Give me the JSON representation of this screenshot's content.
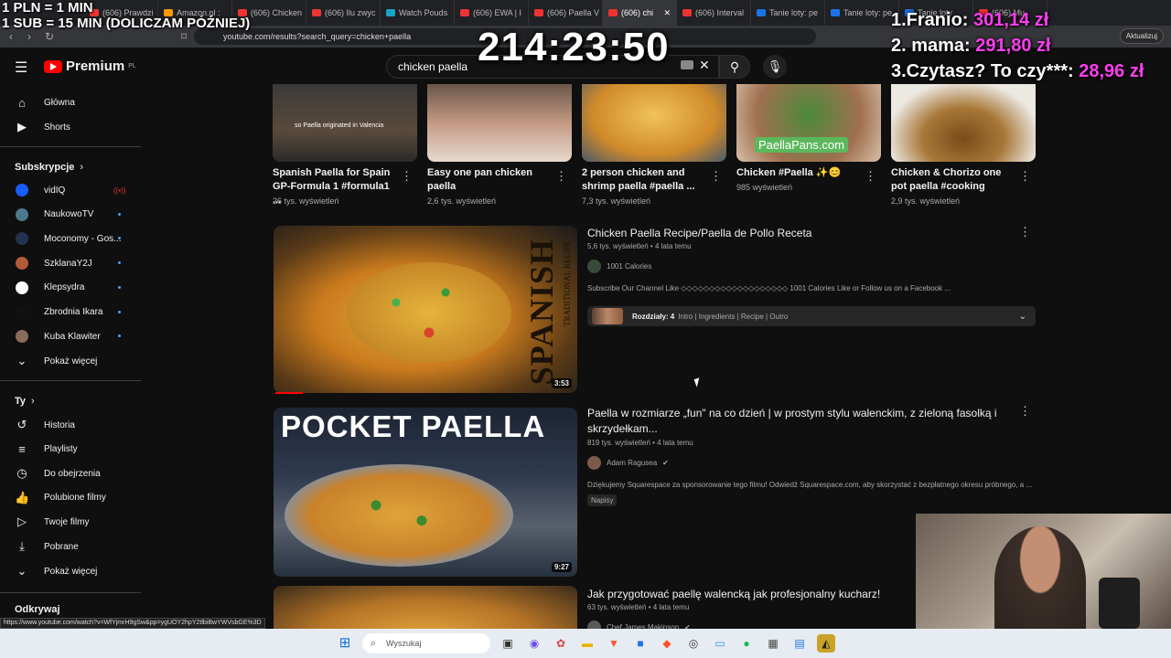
{
  "browser": {
    "tabs": [
      {
        "label": "(606) Prawdzi",
        "icon": "youtube"
      },
      {
        "label": "Amazon.pl :",
        "icon": "amazon"
      },
      {
        "label": "(606) Chicken",
        "icon": "youtube"
      },
      {
        "label": "(606) Ilu zwyc",
        "icon": "youtube"
      },
      {
        "label": "Watch Pouds",
        "icon": "watch"
      },
      {
        "label": "(606) EWA | I",
        "icon": "youtube"
      },
      {
        "label": "(606) Paella V",
        "icon": "youtube"
      },
      {
        "label": "(606) chi",
        "icon": "youtube",
        "active": true
      },
      {
        "label": "(606) Interval",
        "icon": "youtube"
      },
      {
        "label": "Tanie loty: pe",
        "icon": "flights"
      },
      {
        "label": "Tanie loty: pe",
        "icon": "flights"
      },
      {
        "label": "Tanie loty",
        "icon": "flights"
      },
      {
        "label": "(606) Mu",
        "icon": "youtube"
      }
    ],
    "url": "youtube.com/results?search_query=chicken+paella",
    "update_label": "Aktualizuj",
    "status_url": "https://www.youtube.com/watch?v=WfYjmrH9gSw&pp=ygUOY2hpY2tlbiBwYWVsbGE%3D"
  },
  "stream_overlay": {
    "rate_line1": "1 PLN = 1 MIN",
    "rate_line2": "1 SUB = 15 MIN (DOLICZAM PÓŹNIEJ)",
    "timer": "214:23:50",
    "leaderboard": [
      {
        "rank_name": "1.Franio:",
        "amount": "301,14 zł"
      },
      {
        "rank_name": "2. mama:",
        "amount": "291,80 zł"
      },
      {
        "rank_name": "3.Czytasz? To czy***:",
        "amount": "28,96 zł"
      }
    ]
  },
  "youtube": {
    "logo_text": "Premium",
    "logo_region": "PL",
    "search_query": "chicken paella",
    "sidebar": {
      "main": [
        {
          "label": "Główna",
          "icon": "home-icon"
        },
        {
          "label": "Shorts",
          "icon": "shorts-icon"
        }
      ],
      "subscriptions_header": "Subskrypcje",
      "subscriptions": [
        {
          "label": "vidIQ",
          "color": "#1a5cff"
        },
        {
          "label": "NaukowoTV",
          "color": "#4a7a8c"
        },
        {
          "label": "Moconomy - Gos...",
          "color": "#22314f"
        },
        {
          "label": "SzklanaY2J",
          "color": "#b35a3a"
        },
        {
          "label": "Klepsydra",
          "color": "#ffffff"
        },
        {
          "label": "Zbrodnia Ikara",
          "color": "#111111"
        },
        {
          "label": "Kuba Klawiter",
          "color": "#8a6a5a"
        }
      ],
      "show_more_1": "Pokaż więcej",
      "you_header": "Ty",
      "you_items": [
        {
          "label": "Historia",
          "icon": "history-icon"
        },
        {
          "label": "Playlisty",
          "icon": "playlist-icon"
        },
        {
          "label": "Do obejrzenia",
          "icon": "watch-later-icon"
        },
        {
          "label": "Polubione filmy",
          "icon": "like-icon"
        },
        {
          "label": "Twoje filmy",
          "icon": "your-videos-icon"
        },
        {
          "label": "Pobrane",
          "icon": "download-icon"
        }
      ],
      "show_more_2": "Pokaż więcej",
      "explore_header": "Odkrywaj"
    },
    "shorts": [
      {
        "title": "Spanish Paella for Spain GP-Formula 1 #formula1 ...",
        "views": "26 tys. wyświetleń",
        "caption": "so Paella originated in Valencia"
      },
      {
        "title": "Easy one pan chicken paella",
        "views": "2,6 tys. wyświetleń"
      },
      {
        "title": "2 person chicken and shrimp paella #paella ...",
        "views": "7,3 tys. wyświetleń"
      },
      {
        "title": "Chicken #Paella ✨😊",
        "views": "985 wyświetleń",
        "caption": "PaellaPans.com"
      },
      {
        "title": "Chicken & Chorizo one pot paella #cooking",
        "views": "2,9 tys. wyświetleń"
      }
    ],
    "videos": [
      {
        "title": "Chicken Paella Recipe/Paella de Pollo Receta",
        "meta": "5,6 tys. wyświetleń • 4 lata temu",
        "channel": "1001 Calories",
        "description": "Subscribe Our Channel Like ◇◇◇◇◇◇◇◇◇◇◇◇◇◇◇◇◇◇◇ 1001 Calories Like or Follow us on a Facebook ...",
        "duration": "3:53",
        "thumb_text_big": "SPANISH",
        "thumb_text_small": "TRADITIONAL RECIPE",
        "chapters_label": "Rozdziały: 4",
        "chapters_list": "Intro | Ingredients | Recipe | Outro"
      },
      {
        "title": "Paella w rozmiarze „fun\" na co dzień | w prostym stylu walenckim, z zieloną fasolką i skrzydełkam...",
        "meta": "819 tys. wyświetleń • 4 lata temu",
        "channel": "Adam Ragusea",
        "verified": "✔",
        "description": "Dziękujemy Squarespace za sponsorowanie tego filmu! Odwiedź Squarespace.com, aby skorzystać z bezpłatnego okresu próbnego, a ...",
        "badge": "Napisy",
        "duration": "9:27",
        "thumb_text": "POCKET PAELLA"
      },
      {
        "title": "Jak przygotować paellę walencką jak profesjonalny kucharz!",
        "meta": "63 tys. wyświetleń • 4 lata temu",
        "channel": "Chef James Makinson",
        "verified": "✔"
      }
    ]
  },
  "taskbar": {
    "search_placeholder": "Wyszukaj"
  }
}
